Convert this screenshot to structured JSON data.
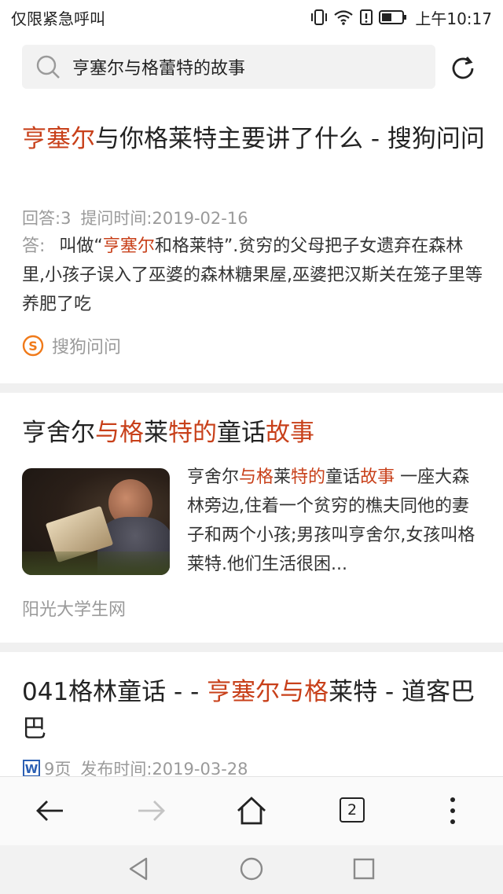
{
  "status": {
    "carrier": "仅限紧急呼叫",
    "time": "上午10:17"
  },
  "search": {
    "query": "亨塞尔与格蕾特的故事"
  },
  "results": [
    {
      "title_parts": [
        {
          "text": "亨塞尔",
          "hl": true
        },
        {
          "text": "与你格莱特主要讲了什么 - 搜狗问问",
          "hl": false
        }
      ],
      "meta_answers": "回答:3",
      "meta_time": "提问时间:2019-02-16",
      "answer_label": "答:",
      "snippet_parts": [
        {
          "text": "叫做“",
          "hl": false
        },
        {
          "text": "亨塞尔",
          "hl": true
        },
        {
          "text": "和格莱特”.贫穷的父母把子女遗弃在森林里,小孩子误入了巫婆的森林糖果屋,巫婆把汉斯关在笼子里等养肥了吃",
          "hl": false
        }
      ],
      "source": "搜狗问问"
    },
    {
      "title_parts": [
        {
          "text": "亨舍尔",
          "hl": false
        },
        {
          "text": "与格",
          "hl": true
        },
        {
          "text": "莱",
          "hl": false
        },
        {
          "text": "特的",
          "hl": true
        },
        {
          "text": "童话",
          "hl": false
        },
        {
          "text": "故事",
          "hl": true
        }
      ],
      "snippet_parts": [
        {
          "text": "亨舍尔",
          "hl": false
        },
        {
          "text": "与格",
          "hl": true
        },
        {
          "text": "莱",
          "hl": false
        },
        {
          "text": "特的",
          "hl": true
        },
        {
          "text": "童话",
          "hl": false
        },
        {
          "text": "故事",
          "hl": true
        },
        {
          "text": " 一座大森林旁边,住着一个贫穷的樵夫同他的妻子和两个小孩;男孩叫亨舍尔,女孩叫格莱特.他们生活很困...",
          "hl": false
        }
      ],
      "source": "阳光大学生网"
    },
    {
      "title_parts": [
        {
          "text": "041格林童话 - - ",
          "hl": false
        },
        {
          "text": "亨塞尔与格",
          "hl": true
        },
        {
          "text": "莱特 - 道客巴巴",
          "hl": false
        }
      ],
      "meta_pages": "9页",
      "meta_time": "发布时间:2019-03-28"
    }
  ],
  "nav": {
    "tab_count": "2"
  },
  "colors": {
    "highlight": "#c8401a",
    "meta_gray": "#9a9a9a",
    "separator": "#f0f0f0"
  },
  "icons": [
    "search-icon",
    "refresh-icon",
    "back-icon",
    "forward-icon",
    "home-icon",
    "tabs-icon",
    "more-icon",
    "doc-icon",
    "sogou-logo-icon"
  ]
}
